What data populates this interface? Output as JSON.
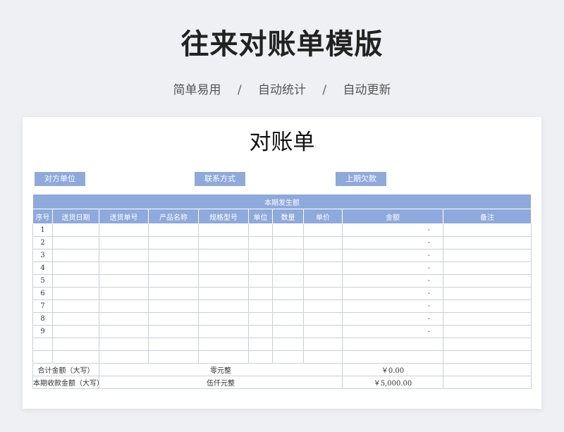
{
  "header": {
    "title": "往来对账单模版",
    "subtitle_items": [
      "简单易用",
      "自动统计",
      "自动更新"
    ],
    "separator": "/"
  },
  "sheet": {
    "title": "对账单",
    "info_labels": [
      "对方单位",
      "联系方式",
      "上期欠款"
    ],
    "section_header": "本期发生额",
    "columns": [
      "序号",
      "送货日期",
      "送货单号",
      "产品名称",
      "规格型号",
      "单位",
      "数量",
      "单价",
      "金额",
      "备注"
    ],
    "rows": [
      {
        "no": "1",
        "amount": "-"
      },
      {
        "no": "2",
        "amount": "-"
      },
      {
        "no": "3",
        "amount": "-"
      },
      {
        "no": "4",
        "amount": "-"
      },
      {
        "no": "5",
        "amount": "-"
      },
      {
        "no": "6",
        "amount": "-"
      },
      {
        "no": "7",
        "amount": "-"
      },
      {
        "no": "8",
        "amount": "-"
      },
      {
        "no": "9",
        "amount": "-"
      },
      {
        "no": "",
        "amount": ""
      },
      {
        "no": "",
        "amount": ""
      }
    ],
    "summary": [
      {
        "label": "合计金额（大写）",
        "words": "零元整",
        "amount": "￥0.00"
      },
      {
        "label": "本期收款金额（大写）",
        "words": "伍仟元整",
        "amount": "￥5,000.00"
      }
    ]
  },
  "colors": {
    "accent": "#8ea9db",
    "background": "#eef0f4"
  }
}
